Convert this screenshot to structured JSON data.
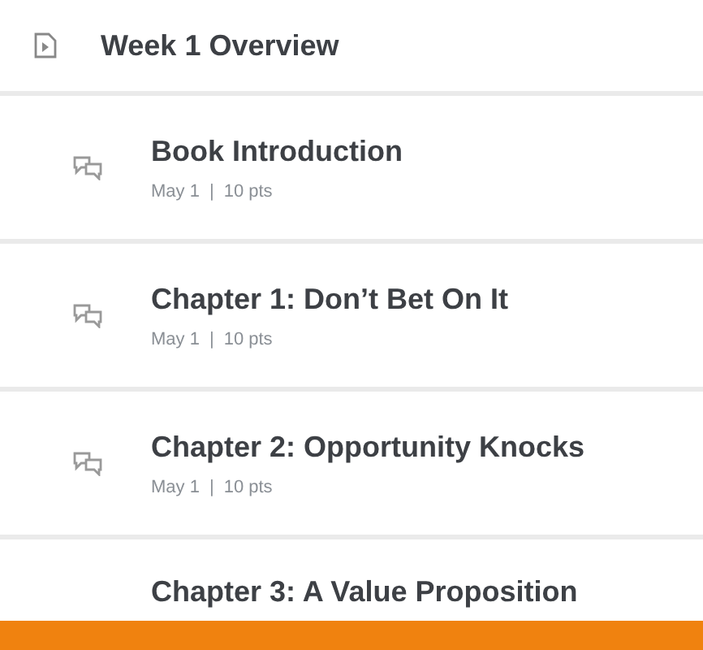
{
  "module": {
    "title": "Week 1 Overview"
  },
  "items": [
    {
      "kind": "discussion",
      "title": "Book Introduction",
      "date": "May 1",
      "separator": "|",
      "points": "10 pts"
    },
    {
      "kind": "discussion",
      "title": "Chapter 1: Don’t Bet On It",
      "date": "May 1",
      "separator": "|",
      "points": "10 pts"
    },
    {
      "kind": "discussion",
      "title": "Chapter 2: Opportunity Knocks",
      "date": "May 1",
      "separator": "|",
      "points": "10 pts"
    },
    {
      "kind": "partial",
      "title": "Chapter 3: A Value Proposition"
    }
  ]
}
